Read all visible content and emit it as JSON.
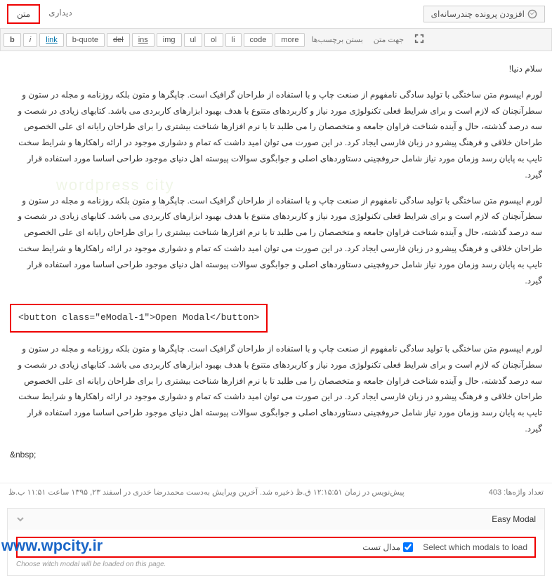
{
  "topbar": {
    "media_label": "افزودن پرونده چندرسانه‌ای",
    "tab_visual": "دیداری",
    "tab_text": "متن"
  },
  "toolbar": {
    "b": "b",
    "i": "i",
    "link": "link",
    "bquote": "b-quote",
    "del": "del",
    "ins": "ins",
    "img": "img",
    "ul": "ul",
    "ol": "ol",
    "li": "li",
    "code": "code",
    "more": "more",
    "close_tags": "بستن برچسب‌ها",
    "text_dir": "جهت متن"
  },
  "editor": {
    "greeting": "سلام دنیا!",
    "para1": "لورم ایپسوم متن ساختگی با تولید سادگی نامفهوم از صنعت چاپ و با استفاده از طراحان گرافیک است. چاپگرها و متون بلکه روزنامه و مجله در ستون و سطرآنچنان که لازم است و برای شرایط فعلی تکنولوژی مورد نیاز و کاربردهای متنوع با هدف بهبود ابزارهای کاربردی می باشد. کتابهای زیادی در شصت و سه درصد گذشته، حال و آینده شناخت فراوان جامعه و متخصصان را می طلبد تا با نرم افزارها شناخت بیشتری را برای طراحان رایانه ای علی الخصوص طراحان خلاقی و فرهنگ پیشرو در زبان فارسی ایجاد کرد. در این صورت می توان امید داشت که تمام و دشواری موجود در ارائه راهکارها و شرایط سخت تایپ به پایان رسد وزمان مورد نیاز شامل حروفچینی دستاوردهای اصلی و جوابگوی سوالات پیوسته اهل دنیای موجود طراحی اساسا مورد استفاده قرار گیرد.",
    "para2": "لورم ایپسوم متن ساختگی با تولید سادگی نامفهوم از صنعت چاپ و با استفاده از طراحان گرافیک است. چاپگرها و متون بلکه روزنامه و مجله در ستون و سطرآنچنان که لازم است و برای شرایط فعلی تکنولوژی مورد نیاز و کاربردهای متنوع با هدف بهبود ابزارهای کاربردی می باشد. کتابهای زیادی در شصت و سه درصد گذشته، حال و آینده شناخت فراوان جامعه و متخصصان را می طلبد تا با نرم افزارها شناخت بیشتری را برای طراحان رایانه ای علی الخصوص طراحان خلاقی و فرهنگ پیشرو در زبان فارسی ایجاد کرد. در این صورت می توان امید داشت که تمام و دشواری موجود در ارائه راهکارها و شرایط سخت تایپ به پایان رسد وزمان مورد نیاز شامل حروفچینی دستاوردهای اصلی و جوابگوی سوالات پیوسته اهل دنیای موجود طراحی اساسا مورد استفاده قرار گیرد.",
    "code_snippet": "<button class=\"eModal-1\">Open Modal</button>",
    "para3": "لورم ایپسوم متن ساختگی با تولید سادگی نامفهوم از صنعت چاپ و با استفاده از طراحان گرافیک است. چاپگرها و متون بلکه روزنامه و مجله در ستون و سطرآنچنان که لازم است و برای شرایط فعلی تکنولوژی مورد نیاز و کاربردهای متنوع با هدف بهبود ابزارهای کاربردی می باشد. کتابهای زیادی در شصت و سه درصد گذشته، حال و آینده شناخت فراوان جامعه و متخصصان را می طلبد تا با نرم افزارها شناخت بیشتری را برای طراحان رایانه ای علی الخصوص طراحان خلاقی و فرهنگ پیشرو در زبان فارسی ایجاد کرد. در این صورت می توان امید داشت که تمام و دشواری موجود در ارائه راهکارها و شرایط سخت تایپ به پایان رسد وزمان مورد نیاز شامل حروفچینی دستاوردهای اصلی و جوابگوی سوالات پیوسته اهل دنیای موجود طراحی اساسا مورد استفاده قرار گیرد.",
    "nbsp": "&nbsp;"
  },
  "status": {
    "word_count": "تعداد واژه‌ها: 403",
    "draft_info": "پیش‌نویس در زمان ۱۲:۱۵:۵۱ ق.ظ ذخیره شد. آخرین ویرایش به‌دست محمدرضا خدری در اسفند ۲۳, ۱۳۹۵ ساعت ۱۱:۵۱ ب.ظ"
  },
  "metabox": {
    "title": "Easy Modal",
    "select_label": "Select which modals to load",
    "option1": "مدال تست",
    "desc": "Choose witch modal will be loaded on this page."
  },
  "watermark": {
    "txt": "wordpress city",
    "sub": "www.wpcity.ir"
  },
  "site_url": "www.wpcity.ir"
}
